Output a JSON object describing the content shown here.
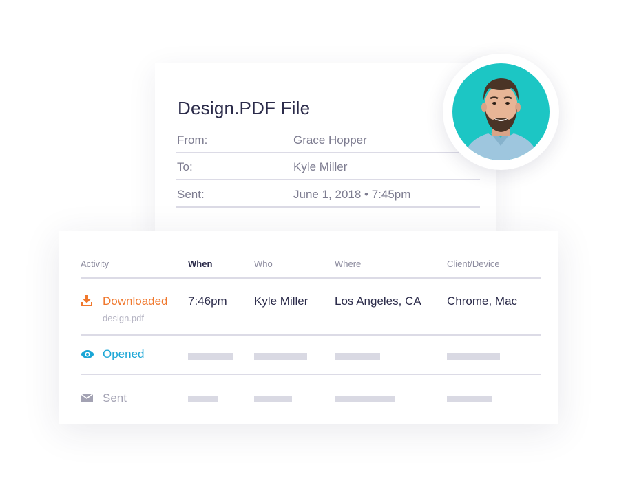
{
  "email": {
    "title": "Design.PDF File",
    "rows": [
      {
        "label": "From:",
        "value": "Grace Hopper"
      },
      {
        "label": "To:",
        "value": "Kyle Miller"
      },
      {
        "label": "Sent:",
        "value": "June 1, 2018 • 7:45pm"
      }
    ]
  },
  "activity_table": {
    "headers": [
      "Activity",
      "When",
      "Who",
      "Where",
      "Client/Device"
    ],
    "rows": [
      {
        "activity": "Downloaded",
        "file": "design.pdf",
        "when": "7:46pm",
        "who": "Kyle Miller",
        "where": "Los Angeles, CA",
        "device": "Chrome, Mac",
        "icon": "download-icon",
        "color": "#f0782d"
      },
      {
        "activity": "Opened",
        "icon": "eye-icon",
        "color": "#1aa6d6"
      },
      {
        "activity": "Sent",
        "icon": "envelope-icon",
        "color": "#a3a2b3"
      }
    ]
  },
  "colors": {
    "accent_orange": "#f0782d",
    "accent_blue": "#1aa6d6",
    "avatar_bg": "#1cc6c4",
    "text_dark": "#2b2b4a",
    "text_muted": "#7d7c90"
  }
}
